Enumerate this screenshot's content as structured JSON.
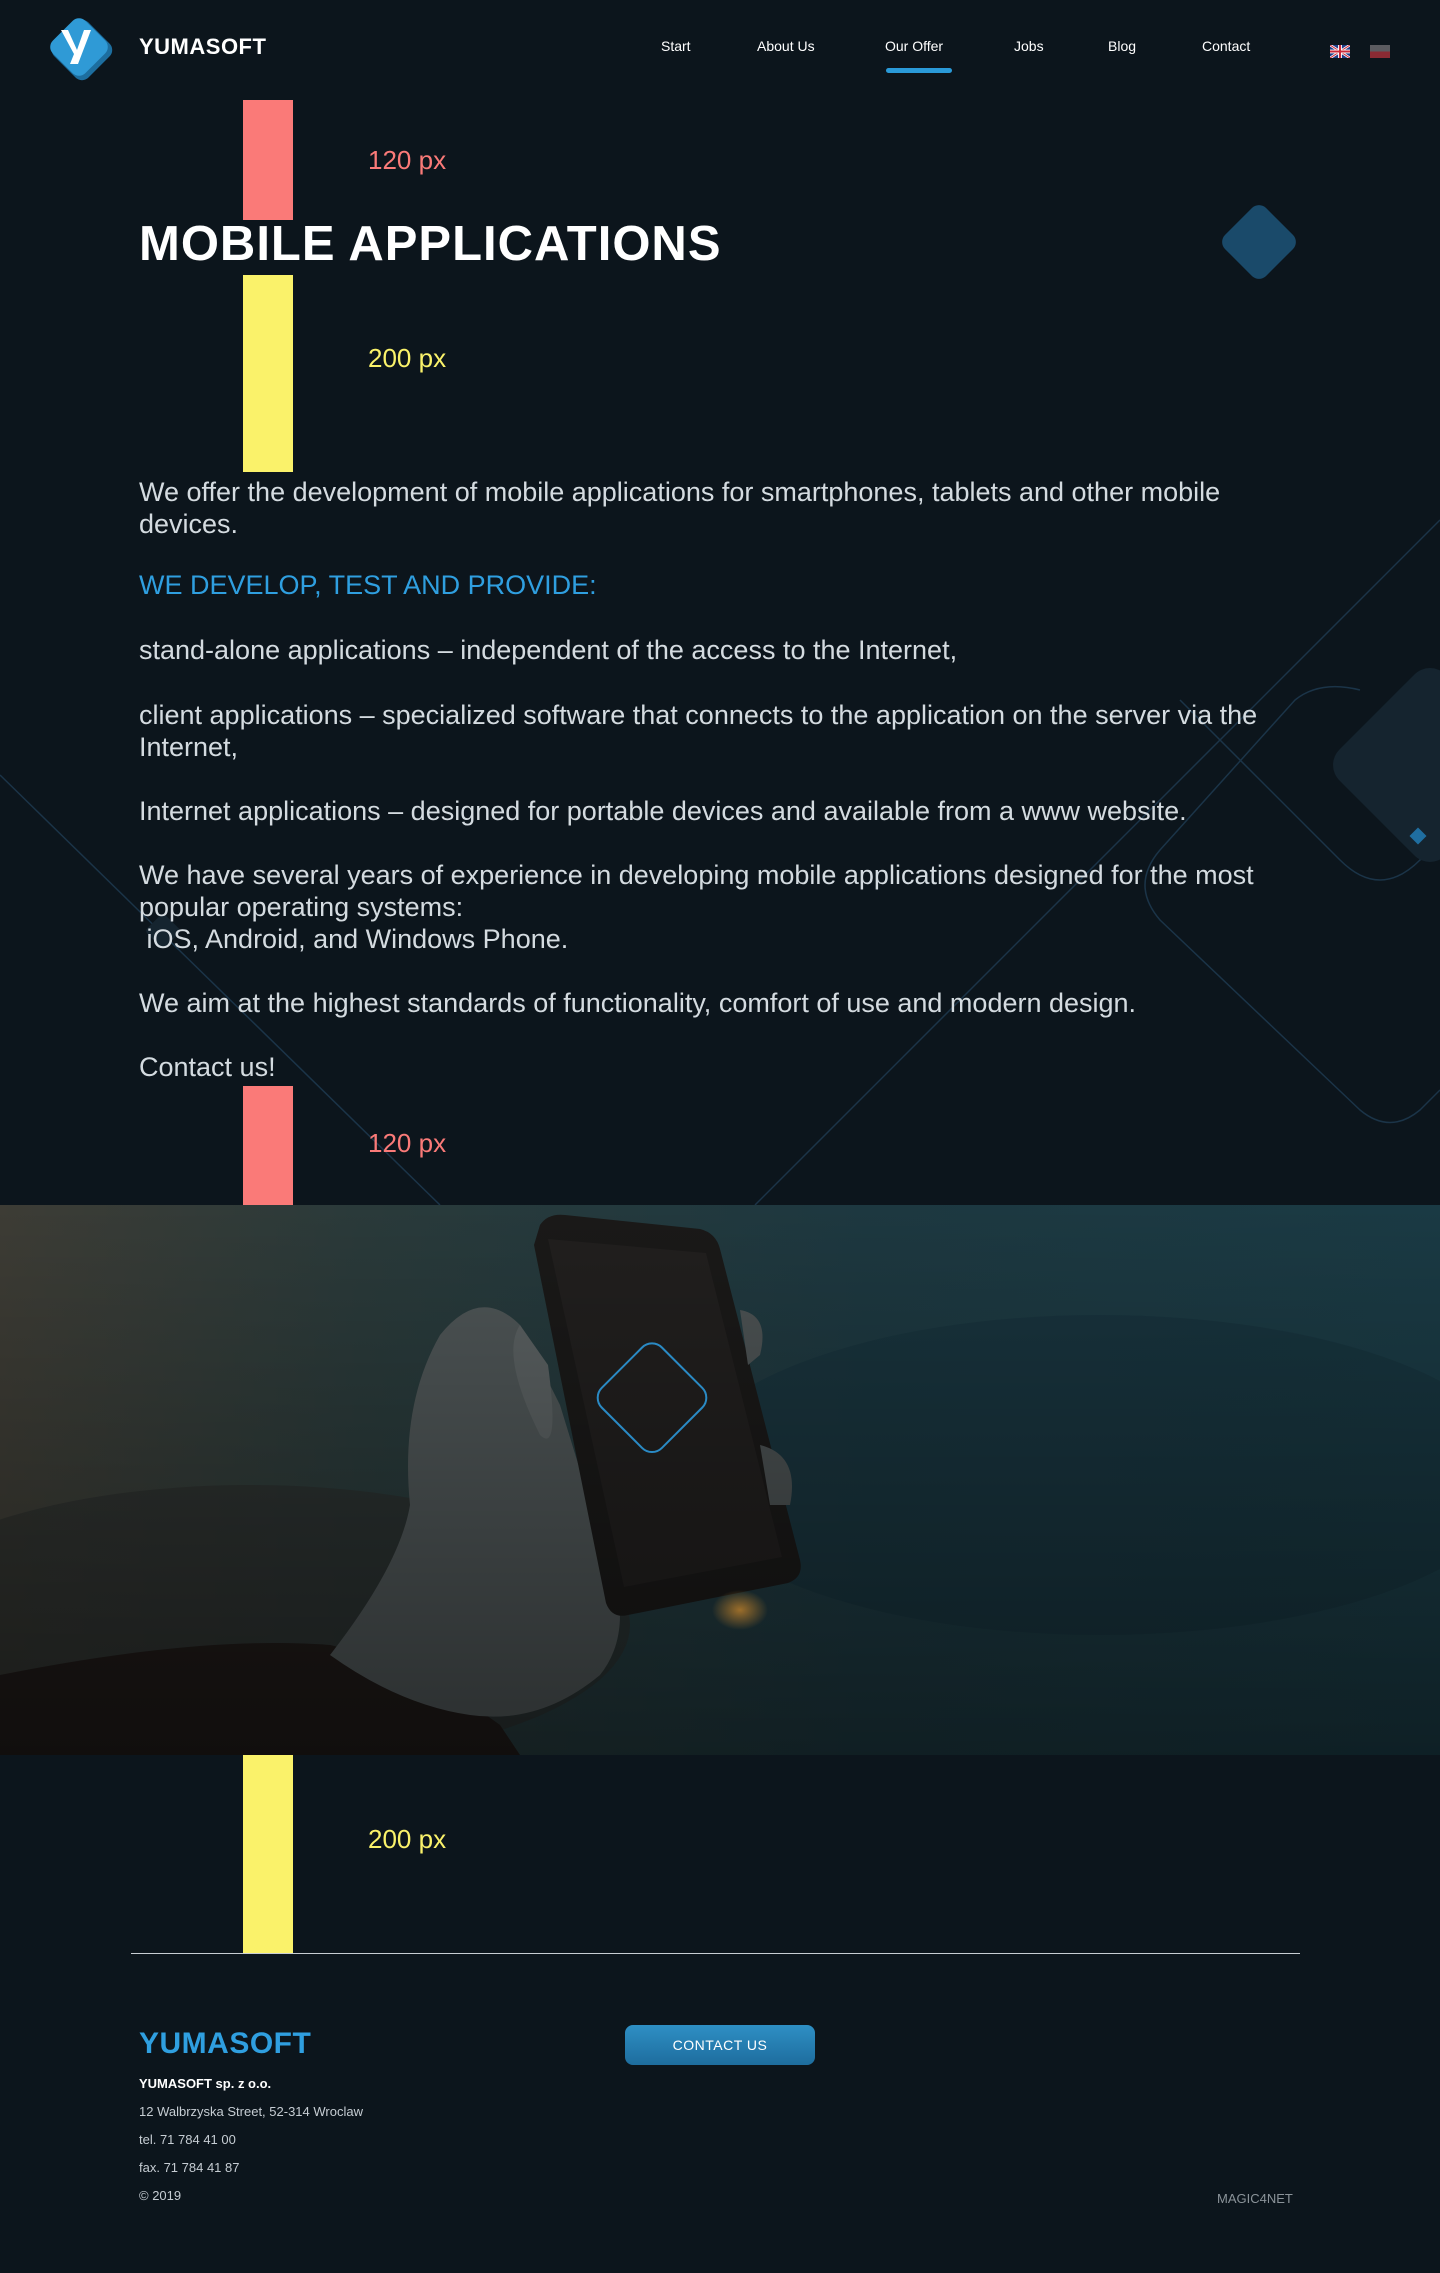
{
  "header": {
    "brand": "YUMASOFT",
    "nav": [
      "Start",
      "About Us",
      "Our Offer",
      "Jobs",
      "Blog",
      "Contact"
    ],
    "active_nav": "Our Offer",
    "languages": [
      "English",
      "Polish"
    ]
  },
  "spacers": {
    "top": "120 px",
    "after_title": "200 px",
    "after_content": "120 px",
    "after_photo": "200 px"
  },
  "main": {
    "title": "MOBILE APPLICATIONS",
    "intro": "We offer the development of mobile applications for smartphones, tablets and other mobile devices.",
    "subheading": "WE DEVELOP, TEST AND PROVIDE:",
    "item1": "stand-alone applications – independent of the access to the Internet,",
    "item2": "client applications – specialized software that connects to the application on the server via the Internet,",
    "item3": "Internet applications – designed for portable devices and available from a www website.",
    "experience_1": "We have several years of experience in developing mobile applications designed for the most popular operating systems:",
    "experience_2": " iOS, Android, and Windows Phone.",
    "standards": "We aim at the highest standards of functionality, comfort of use and modern design.",
    "contact_line": "Contact us!"
  },
  "footer": {
    "brand": "YUMASOFT",
    "company": "YUMASOFT sp. z o.o.",
    "address": "12 Walbrzyska Street, 52-314 Wroclaw",
    "tel": "tel. 71 784 41 00",
    "fax": "fax. 71 784 41 87",
    "copyright": "© 2019",
    "contact_button": "CONTACT US",
    "credit": "MAGIC4NET"
  },
  "colors": {
    "background": "#0c151c",
    "accent_blue": "#2f9fe0",
    "spacer_red": "#fa7a78",
    "spacer_yellow": "#faf26a"
  },
  "icons": [
    "logo-icon",
    "uk-flag-icon",
    "pl-flag-icon"
  ]
}
